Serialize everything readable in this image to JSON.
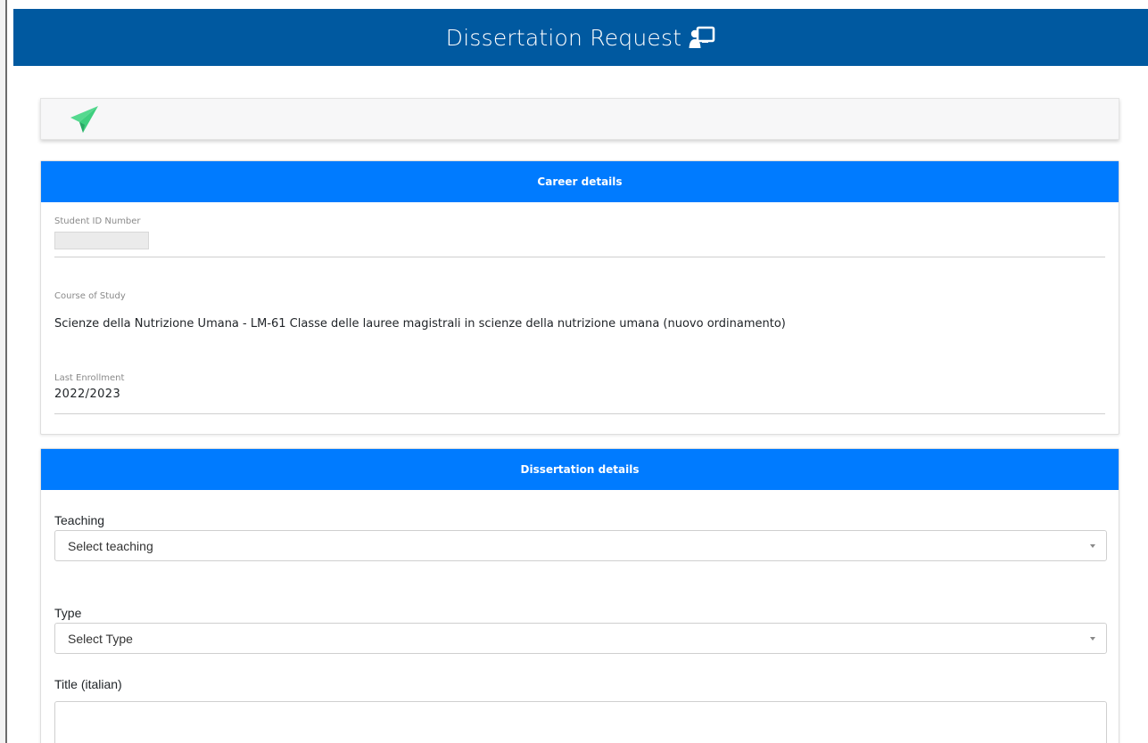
{
  "header": {
    "title": "Dissertation Request",
    "icon": "teacher-board-icon"
  },
  "toolbar": {
    "send_icon": "paper-plane-icon"
  },
  "career": {
    "title": "Career details",
    "student_id_label": "Student ID Number",
    "student_id_value": "",
    "course_label": "Course of Study",
    "course_value": "Scienze della Nutrizione Umana - LM-61 Classe delle lauree magistrali in scienze della nutrizione umana (nuovo ordinamento)",
    "enrollment_label": "Last Enrollment",
    "enrollment_value": "2022/2023"
  },
  "dissertation": {
    "title": "Dissertation details",
    "teaching_label": "Teaching",
    "teaching_placeholder": "Select teaching",
    "type_label": "Type",
    "type_placeholder": "Select Type",
    "title_it_label": "Title (italian)",
    "title_it_value": ""
  },
  "colors": {
    "header_bg": "#0059a0",
    "card_header_bg": "#007bff",
    "send_icon": "#3fcf7f"
  }
}
